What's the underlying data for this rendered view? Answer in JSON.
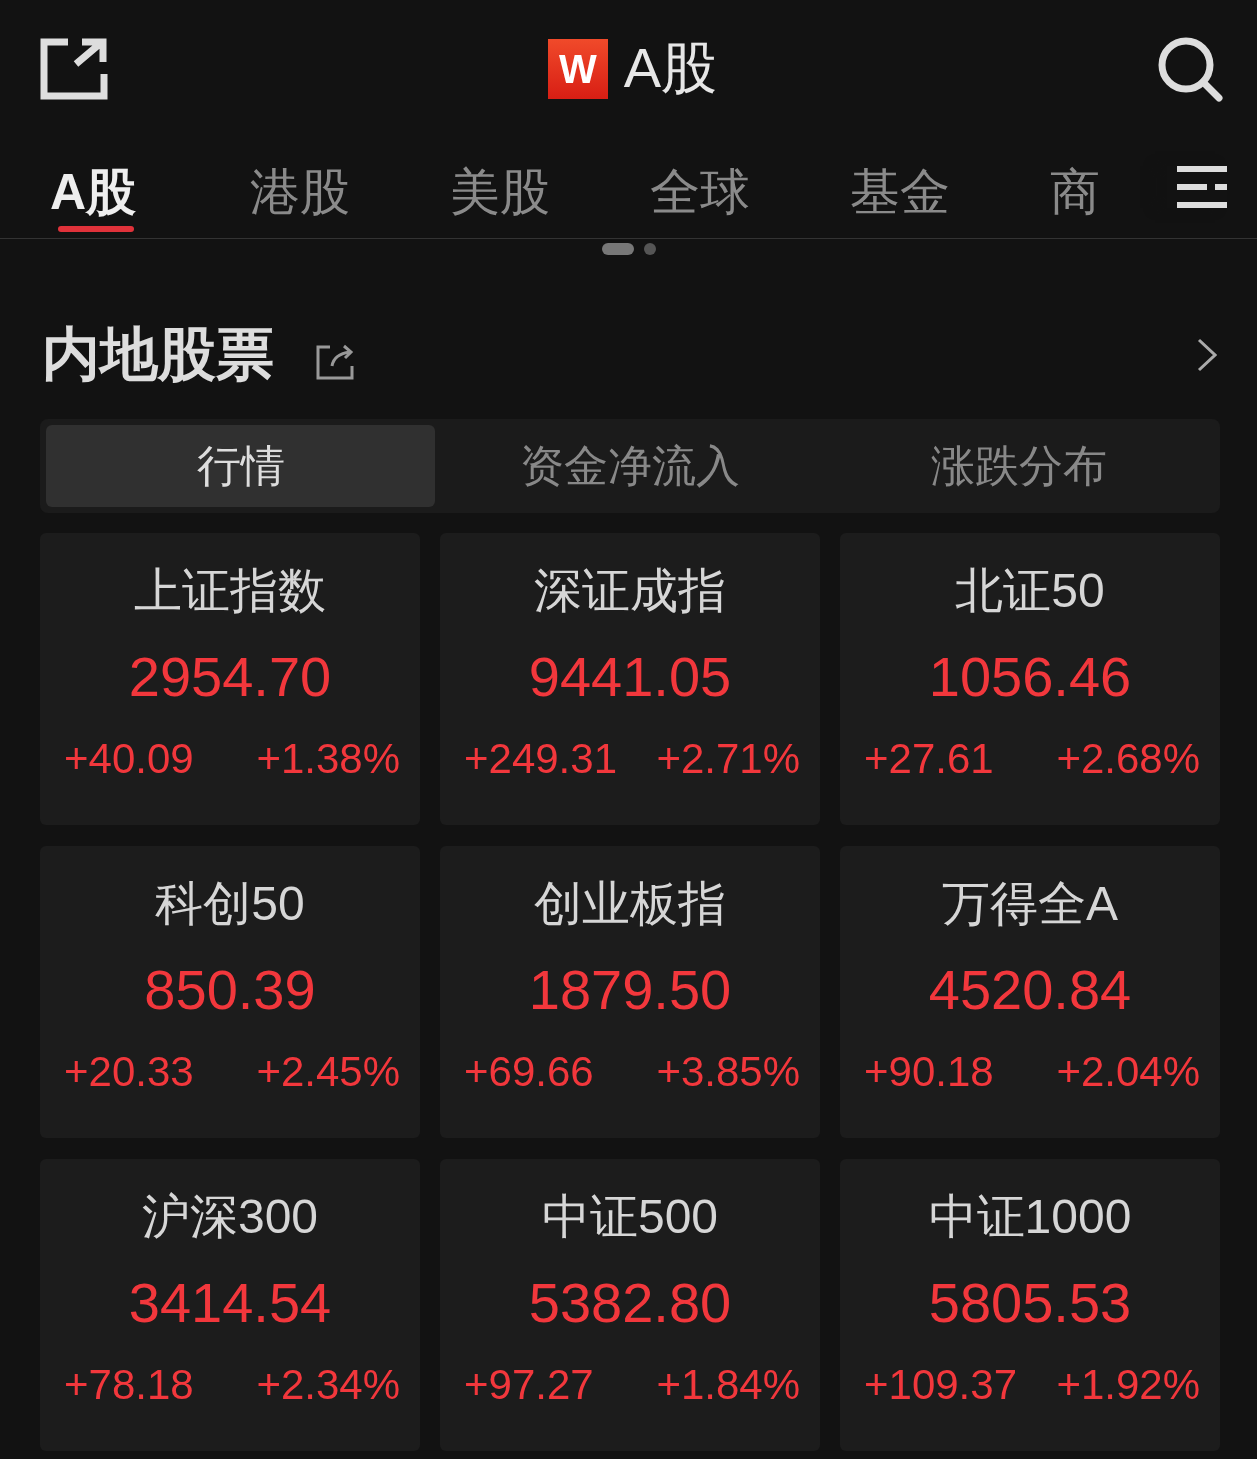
{
  "header": {
    "logo": "W",
    "title": "A股"
  },
  "tabs": [
    {
      "label": "A股",
      "selected": true
    },
    {
      "label": "港股",
      "selected": false
    },
    {
      "label": "美股",
      "selected": false
    },
    {
      "label": "全球",
      "selected": false
    },
    {
      "label": "基金",
      "selected": false
    },
    {
      "label": "商",
      "selected": false
    }
  ],
  "pager": [
    {
      "selected": true
    },
    {
      "selected": false
    }
  ],
  "section": {
    "title": "内地股票"
  },
  "segments": [
    {
      "label": "行情",
      "selected": true
    },
    {
      "label": "资金净流入",
      "selected": false
    },
    {
      "label": "涨跌分布",
      "selected": false
    }
  ],
  "quotes": [
    {
      "name": "上证指数",
      "value": "2954.70",
      "change": "+40.09",
      "percent": "+1.38%"
    },
    {
      "name": "深证成指",
      "value": "9441.05",
      "change": "+249.31",
      "percent": "+2.71%"
    },
    {
      "name": "北证50",
      "value": "1056.46",
      "change": "+27.61",
      "percent": "+2.68%"
    },
    {
      "name": "科创50",
      "value": "850.39",
      "change": "+20.33",
      "percent": "+2.45%"
    },
    {
      "name": "创业板指",
      "value": "1879.50",
      "change": "+69.66",
      "percent": "+3.85%"
    },
    {
      "name": "万得全A",
      "value": "4520.84",
      "change": "+90.18",
      "percent": "+2.04%"
    },
    {
      "name": "沪深300",
      "value": "3414.54",
      "change": "+78.18",
      "percent": "+2.34%"
    },
    {
      "name": "中证500",
      "value": "5382.80",
      "change": "+97.27",
      "percent": "+1.84%"
    },
    {
      "name": "中证1000",
      "value": "5805.53",
      "change": "+109.37",
      "percent": "+1.92%"
    }
  ]
}
